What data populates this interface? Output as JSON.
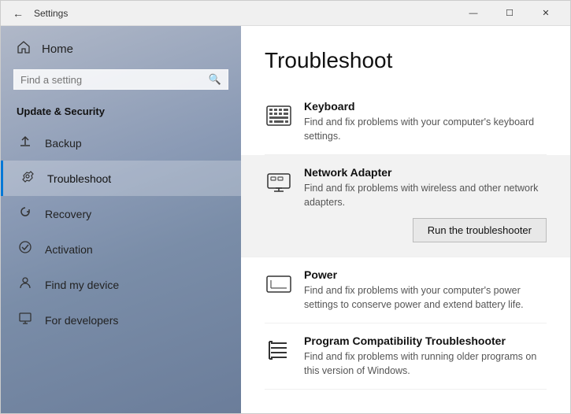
{
  "titlebar": {
    "title": "Settings",
    "back_label": "←",
    "controls": {
      "minimize": "—",
      "maximize": "☐",
      "close": "✕"
    }
  },
  "sidebar": {
    "home_label": "Home",
    "search_placeholder": "Find a setting",
    "section_title": "Update & Security",
    "items": [
      {
        "id": "backup",
        "label": "Backup",
        "icon": "↑"
      },
      {
        "id": "troubleshoot",
        "label": "Troubleshoot",
        "icon": "🔑",
        "active": true
      },
      {
        "id": "recovery",
        "label": "Recovery",
        "icon": "↺"
      },
      {
        "id": "activation",
        "label": "Activation",
        "icon": "✓"
      },
      {
        "id": "find-my-device",
        "label": "Find my device",
        "icon": "👤"
      },
      {
        "id": "for-developers",
        "label": "For developers",
        "icon": "⚙"
      }
    ]
  },
  "main": {
    "page_title": "Troubleshoot",
    "items": [
      {
        "id": "keyboard",
        "name": "Keyboard",
        "desc": "Find and fix problems with your computer's keyboard settings.",
        "highlighted": false
      },
      {
        "id": "network-adapter",
        "name": "Network Adapter",
        "desc": "Find and fix problems with wireless and other network adapters.",
        "highlighted": true,
        "run_btn_label": "Run the troubleshooter"
      },
      {
        "id": "power",
        "name": "Power",
        "desc": "Find and fix problems with your computer's power settings to conserve power and extend battery life.",
        "highlighted": false
      },
      {
        "id": "program-compatibility",
        "name": "Program Compatibility Troubleshooter",
        "desc": "Find and fix problems with running older programs on this version of Windows.",
        "highlighted": false
      }
    ]
  }
}
